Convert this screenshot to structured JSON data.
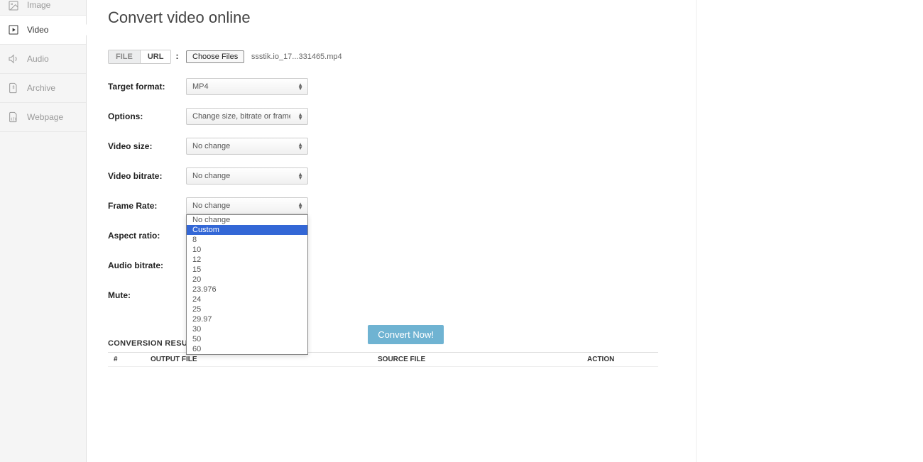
{
  "sidebar": {
    "items": [
      {
        "label": "Image"
      },
      {
        "label": "Video"
      },
      {
        "label": "Audio"
      },
      {
        "label": "Archive"
      },
      {
        "label": "Webpage"
      }
    ]
  },
  "page": {
    "title": "Convert video online"
  },
  "source": {
    "file_tab": "FILE",
    "url_tab": "URL",
    "choose_files": "Choose Files",
    "filename": "ssstik.io_17...331465.mp4"
  },
  "labels": {
    "target_format": "Target format:",
    "options": "Options:",
    "video_size": "Video size:",
    "video_bitrate": "Video bitrate:",
    "frame_rate": "Frame Rate:",
    "aspect_ratio": "Aspect ratio:",
    "audio_bitrate": "Audio bitrate:",
    "mute": "Mute:"
  },
  "selects": {
    "target_format": "MP4",
    "options": "Change size, bitrate or frame rate",
    "video_size": "No change",
    "video_bitrate": "No change",
    "frame_rate": "No change"
  },
  "framerate_dropdown": {
    "options": [
      "No change",
      "Custom",
      "8",
      "10",
      "12",
      "15",
      "20",
      "23.976",
      "24",
      "25",
      "29.97",
      "30",
      "50",
      "60"
    ],
    "highlighted_index": 1
  },
  "convert_button": "Convert Now!",
  "results": {
    "heading": "CONVERSION RESULTS:",
    "columns": {
      "num": "#",
      "output": "OUTPUT FILE",
      "source": "SOURCE FILE",
      "action": "ACTION"
    }
  }
}
